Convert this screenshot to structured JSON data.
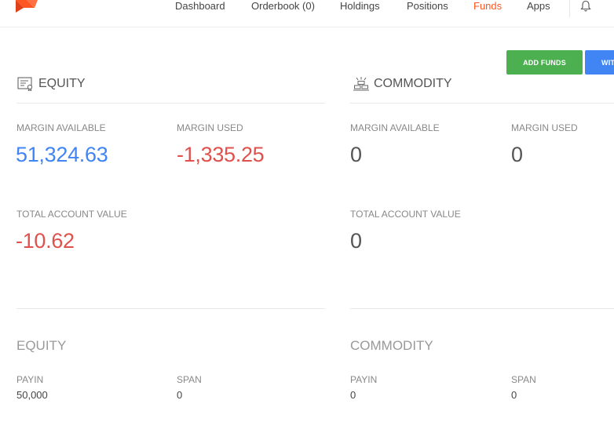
{
  "nav": {
    "items": [
      {
        "label": "Dashboard"
      },
      {
        "label": "Orderbook (0)"
      },
      {
        "label": "Holdings"
      },
      {
        "label": "Positions"
      },
      {
        "label": "Funds"
      },
      {
        "label": "Apps"
      }
    ],
    "active": "Funds",
    "active_color": "#ff5722"
  },
  "buttons": {
    "add_funds": "ADD FUNDS",
    "withdraw": "WITHDRAW"
  },
  "equity": {
    "title": "EQUITY",
    "margin_available_label": "MARGIN AVAILABLE",
    "margin_available": "51,324.63",
    "margin_used_label": "MARGIN USED",
    "margin_used": "-1,335.25",
    "total_label": "TOTAL ACCOUNT VALUE",
    "total": "-10.62",
    "detail": {
      "title": "EQUITY",
      "payin_label": "PAYIN",
      "payin": "50,000",
      "span_label": "SPAN",
      "span": "0"
    }
  },
  "commodity": {
    "title": "COMMODITY",
    "margin_available_label": "MARGIN AVAILABLE",
    "margin_available": "0",
    "margin_used_label": "MARGIN USED",
    "margin_used": "0",
    "total_label": "TOTAL ACCOUNT VALUE",
    "total": "0",
    "detail": {
      "title": "COMMODITY",
      "payin_label": "PAYIN",
      "payin": "0",
      "span_label": "SPAN",
      "span": "0"
    }
  },
  "colors": {
    "positive": "#4184f3",
    "negative": "#df514c",
    "add_button": "#4caf50",
    "withdraw_button": "#4184f3"
  }
}
